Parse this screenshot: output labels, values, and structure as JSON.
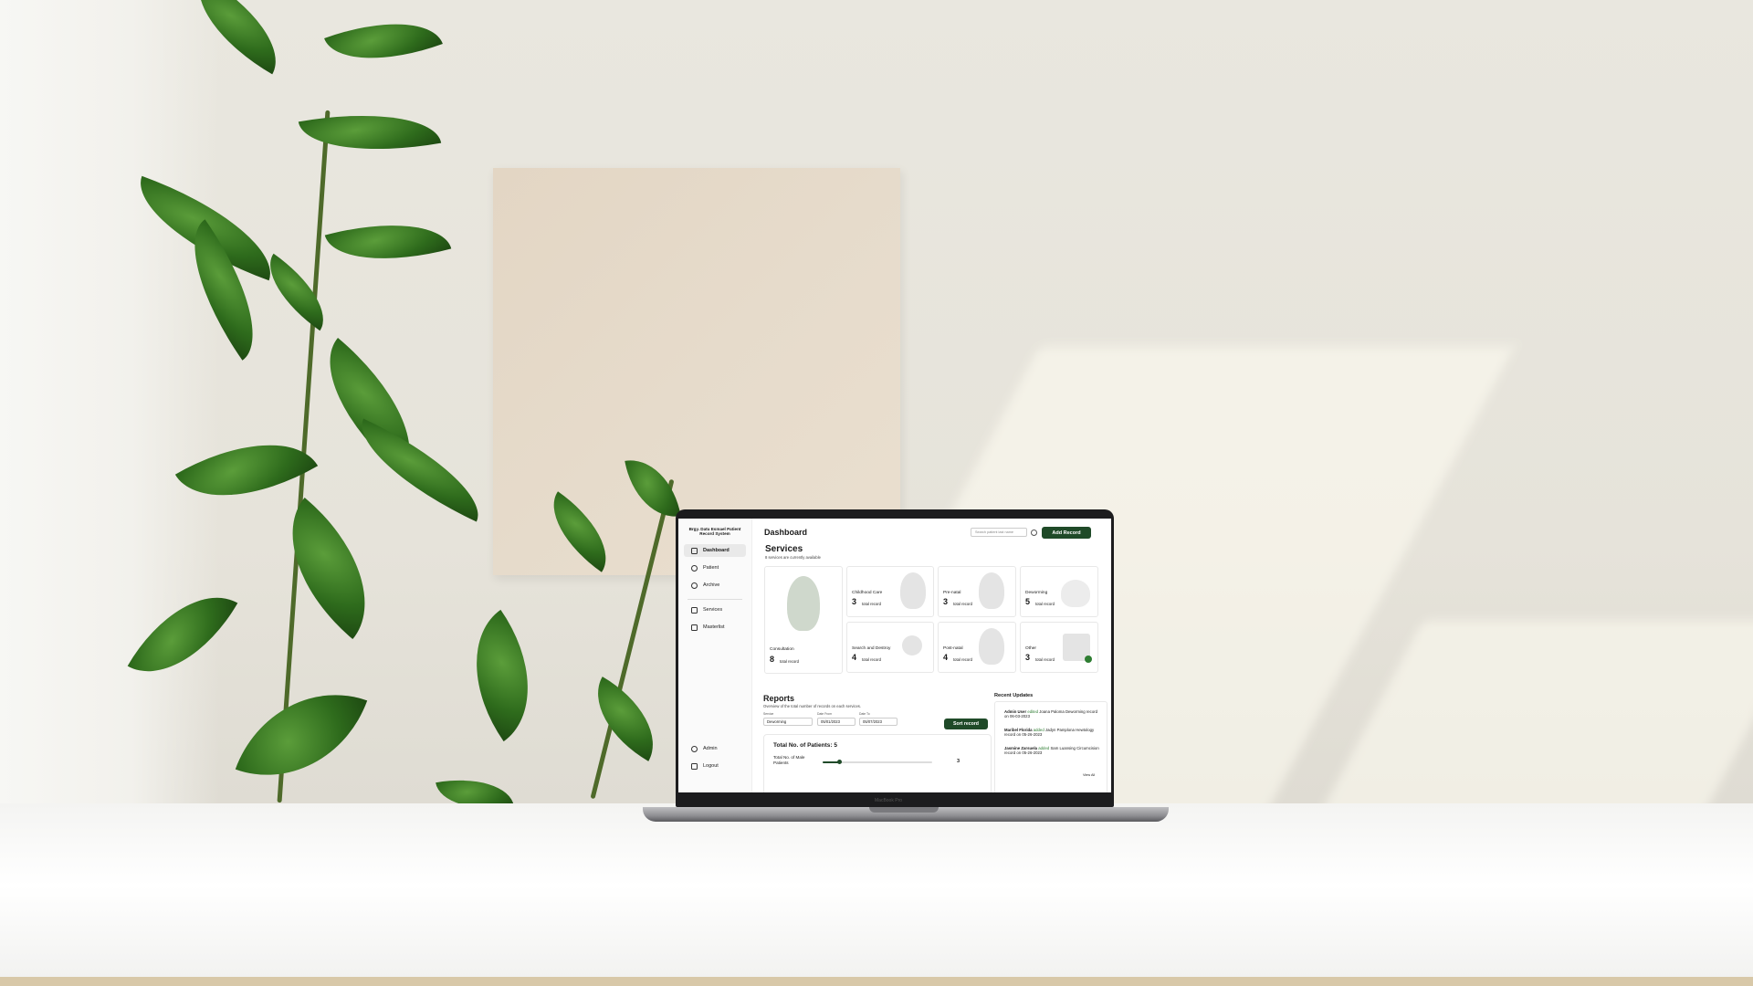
{
  "app": {
    "brand": "Brgy. Datu Esmael Patient Record System",
    "page_title": "Dashboard",
    "search_placeholder": "Search patient last name",
    "add_record_label": "Add Record"
  },
  "sidebar": {
    "items": [
      {
        "label": "Dashboard",
        "icon": "home-icon",
        "active": true
      },
      {
        "label": "Patient",
        "icon": "users-icon",
        "active": false
      },
      {
        "label": "Archive",
        "icon": "history-icon",
        "active": false
      },
      {
        "label": "Services",
        "icon": "grid-icon",
        "active": false
      },
      {
        "label": "Masterlist",
        "icon": "clipboard-icon",
        "active": false
      }
    ],
    "footer": [
      {
        "label": "Admin",
        "icon": "user-circle-icon"
      },
      {
        "label": "Logout",
        "icon": "logout-icon"
      }
    ]
  },
  "services": {
    "title": "Services",
    "subtitle": "8 services are currently available",
    "record_suffix": "total record",
    "cards": [
      {
        "name": "Consultation",
        "count": "8"
      },
      {
        "name": "Childhood Care",
        "count": "3"
      },
      {
        "name": "Pre-natal",
        "count": "3"
      },
      {
        "name": "Deworming",
        "count": "5"
      },
      {
        "name": "Search and Destroy",
        "count": "4"
      },
      {
        "name": "Post-natal",
        "count": "4"
      },
      {
        "name": "Other",
        "count": "3"
      }
    ]
  },
  "reports": {
    "title": "Reports",
    "subtitle": "Overview of the total number of records on each services.",
    "service_label": "Service",
    "service_value": "Deworming",
    "date_from_label": "Date From",
    "date_from_value": "05/01/2023",
    "date_to_label": "Date To",
    "date_to_value": "05/07/2023",
    "sort_label": "Sort record",
    "totals_title": "Total No. of Patients: 5",
    "male_label": "Total No. of Male Patients",
    "male_value": "3",
    "male_fraction": 0.15
  },
  "recent_updates": {
    "title": "Recent Updates",
    "items": [
      {
        "actor": "Admin User",
        "verb": "edited",
        "target": "Joana Paloma",
        "detail": "Deworming record on 06-03-2023"
      },
      {
        "actor": "Maribel Florida",
        "verb": "added",
        "target": "Jadyn Pamplona",
        "detail": "Hewtology record on 05-26-2023"
      },
      {
        "actor": "Jasmine Zarsuela",
        "verb": "added",
        "target": "Sam Luansing",
        "detail": "Circumcision record on 05-26-2023"
      }
    ],
    "view_all": "View All"
  },
  "laptop": {
    "bezel_text": "MacBook Pro"
  },
  "colors": {
    "accent": "#1f4a28",
    "update_verb": "#2e7d32"
  }
}
